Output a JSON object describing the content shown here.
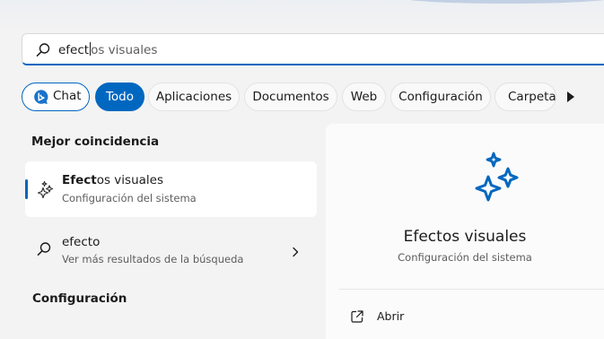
{
  "search": {
    "typed": "efect",
    "suggestion": "os visuales"
  },
  "filters": [
    {
      "label": "Chat"
    },
    {
      "label": "Todo"
    },
    {
      "label": "Aplicaciones"
    },
    {
      "label": "Documentos"
    },
    {
      "label": "Web"
    },
    {
      "label": "Configuración"
    },
    {
      "label": "Carpeta"
    }
  ],
  "active_filter": "Todo",
  "best_match": {
    "section": "Mejor coincidencia",
    "title_bold": "Efect",
    "title_rest": "os visuales",
    "subtitle": "Configuración del sistema"
  },
  "web_suggestion": {
    "title": "efecto",
    "subtitle": "Ver más resultados de la búsqueda"
  },
  "settings_section": "Configuración",
  "preview": {
    "title": "Efectos visuales",
    "subtitle": "Configuración del sistema",
    "actions": [
      {
        "label": "Abrir"
      }
    ]
  },
  "colors": {
    "accent": "#0067c0",
    "background": "#f3f3f3"
  },
  "icons": {
    "search": "search-icon",
    "chat": "bing-chat-icon",
    "result": "sparkles-icon",
    "web": "search-icon",
    "more": "play-arrow-icon",
    "open": "open-external-icon"
  }
}
